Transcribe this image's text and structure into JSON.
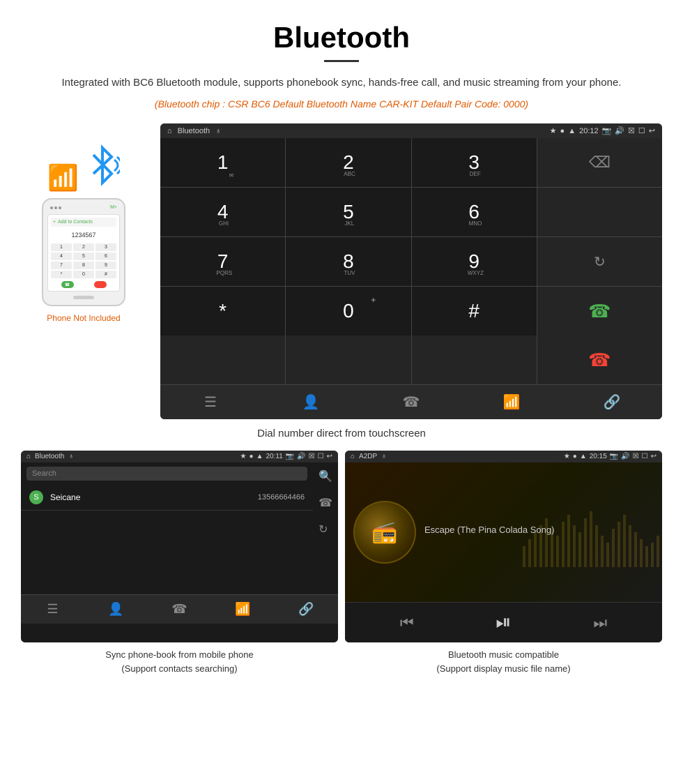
{
  "page": {
    "title": "Bluetooth",
    "divider": true,
    "description": "Integrated with BC6 Bluetooth module, supports phonebook sync, hands-free call, and music streaming from your phone.",
    "specs": "(Bluetooth chip : CSR BC6    Default Bluetooth Name CAR-KIT    Default Pair Code: 0000)"
  },
  "phone": {
    "not_included": "Phone Not Included"
  },
  "dialer_screen": {
    "status_bar": {
      "app_name": "Bluetooth",
      "time": "20:12"
    },
    "keys": [
      {
        "num": "1",
        "sub": ""
      },
      {
        "num": "2",
        "sub": "ABC"
      },
      {
        "num": "3",
        "sub": "DEF"
      },
      {
        "num": "",
        "sub": ""
      },
      {
        "num": "4",
        "sub": "GHI"
      },
      {
        "num": "5",
        "sub": "JKL"
      },
      {
        "num": "6",
        "sub": "MNO"
      },
      {
        "num": "",
        "sub": ""
      },
      {
        "num": "7",
        "sub": "PQRS"
      },
      {
        "num": "8",
        "sub": "TUV"
      },
      {
        "num": "9",
        "sub": "WXYZ"
      },
      {
        "num": "",
        "sub": ""
      },
      {
        "num": "*",
        "sub": ""
      },
      {
        "num": "0",
        "sub": "+"
      },
      {
        "num": "#",
        "sub": ""
      },
      {
        "num": "",
        "sub": ""
      }
    ]
  },
  "dialer_caption": "Dial number direct from touchscreen",
  "phonebook_screen": {
    "status_bar": {
      "app_name": "Bluetooth",
      "time": "20:11"
    },
    "search_placeholder": "Search",
    "contact": {
      "letter": "S",
      "name": "Seicane",
      "number": "13566664466"
    }
  },
  "phonebook_caption_line1": "Sync phone-book from mobile phone",
  "phonebook_caption_line2": "(Support contacts searching)",
  "music_screen": {
    "status_bar": {
      "app_name": "A2DP",
      "time": "20:15"
    },
    "track_name": "Escape (The Pina Colada Song)"
  },
  "music_caption_line1": "Bluetooth music compatible",
  "music_caption_line2": "(Support display music file name)"
}
